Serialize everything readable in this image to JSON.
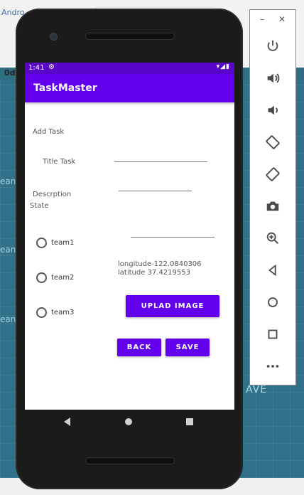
{
  "ide": {
    "tab_text": "Andro",
    "od_text": "0d",
    "side_label": "ean",
    "save_ghost": "AVE"
  },
  "status_bar": {
    "time": "1:41",
    "gear_icon": "gear-icon",
    "right_icons": "▾◢▮"
  },
  "app": {
    "title": "TaskMaster",
    "add_task_label": "Add Task",
    "title_task_label": "Title Task",
    "description_label": "Descrption",
    "state_label": "State",
    "teams": [
      "team1",
      "team2",
      "team3"
    ],
    "location_text": "longitude-122.0840306 latitude 37.4219553",
    "upload_button": "UPLAD IMAGE",
    "back_button": "BACK",
    "save_button": "SAVE"
  },
  "emulator_panel": {
    "minimize": "–",
    "close": "✕",
    "tools": [
      "power-icon",
      "volume-up-icon",
      "volume-down-icon",
      "rotate-left-icon",
      "rotate-right-icon",
      "camera-icon",
      "zoom-icon",
      "back-icon",
      "home-icon",
      "overview-icon",
      "more-icon"
    ]
  },
  "colors": {
    "primary": "#6200ee",
    "status_bar": "#5a06c8",
    "ide_background": "#32718a"
  }
}
